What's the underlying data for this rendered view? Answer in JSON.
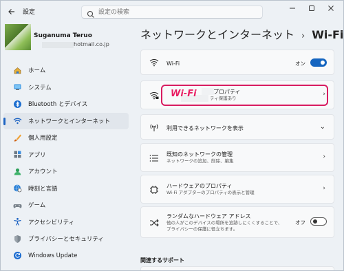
{
  "window": {
    "title": "設定",
    "back_icon": "back-arrow-icon",
    "controls": [
      "minimize",
      "maximize",
      "close"
    ]
  },
  "search": {
    "placeholder": "設定の検索"
  },
  "profile": {
    "name": "Suganuma Teruo",
    "email": "hotmail.co.jp"
  },
  "sidebar": {
    "items": [
      {
        "label": "ホーム",
        "icon": "home-icon",
        "active": false
      },
      {
        "label": "システム",
        "icon": "monitor-icon",
        "active": false
      },
      {
        "label": "Bluetooth とデバイス",
        "icon": "bluetooth-icon",
        "active": false
      },
      {
        "label": "ネットワークとインターネット",
        "icon": "network-icon",
        "active": true
      },
      {
        "label": "個人用設定",
        "icon": "brush-icon",
        "active": false
      },
      {
        "label": "アプリ",
        "icon": "apps-icon",
        "active": false
      },
      {
        "label": "アカウント",
        "icon": "account-icon",
        "active": false
      },
      {
        "label": "時刻と言語",
        "icon": "globe-clock-icon",
        "active": false
      },
      {
        "label": "ゲーム",
        "icon": "gamepad-icon",
        "active": false
      },
      {
        "label": "アクセシビリティ",
        "icon": "accessibility-icon",
        "active": false
      },
      {
        "label": "プライバシーとセキュリティ",
        "icon": "shield-icon",
        "active": false
      },
      {
        "label": "Windows Update",
        "icon": "update-icon",
        "active": false
      }
    ]
  },
  "breadcrumb": {
    "parent": "ネットワークとインターネット",
    "separator": "›",
    "current": "Wi-Fi"
  },
  "cards": {
    "wifi": {
      "title": "Wi-Fi",
      "toggle_label": "オン",
      "toggle_state": "on"
    },
    "properties": {
      "title": "プロパティ",
      "subtitle": "ティ保護あり",
      "annotation": "Wi-Fi"
    },
    "available": {
      "title": "利用できるネットワークを表示"
    },
    "known": {
      "title": "既知のネットワークの管理",
      "subtitle": "ネットワークの追加、削除、編集"
    },
    "hardware": {
      "title": "ハードウェアのプロパティ",
      "subtitle": "Wi-Fi アダプターのプロパティの表示と管理"
    },
    "random": {
      "title": "ランダムなハードウェア アドレス",
      "subtitle_line1": "他の人がこのデバイスの場所を追跡しにくくすることで、",
      "subtitle_line2": "プライバシーの保護に役立ちます。",
      "toggle_label": "オフ",
      "toggle_state": "off"
    }
  },
  "related": {
    "title": "関連するサポート"
  },
  "colors": {
    "accent": "#1565c0",
    "highlight": "#d81b60",
    "annotation": "#e91e63"
  }
}
